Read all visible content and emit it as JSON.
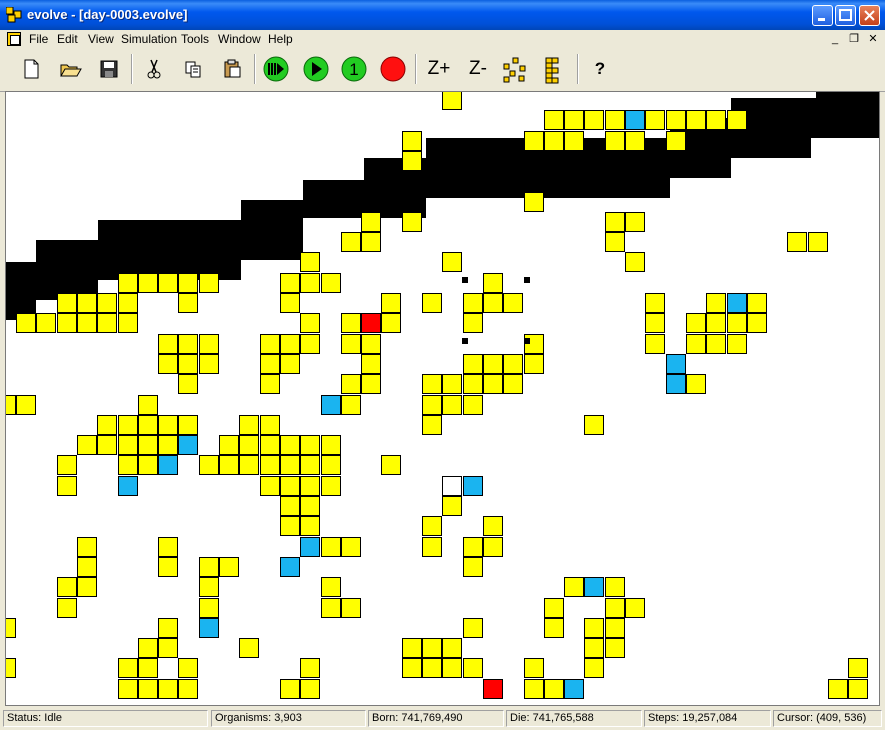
{
  "window": {
    "title": "evolve - [day-0003.evolve]"
  },
  "menu": {
    "items": [
      "File",
      "Edit",
      "View",
      "Simulation",
      "Tools",
      "Window",
      "Help"
    ]
  },
  "toolbar": {
    "zoom_in_label": "Z+",
    "zoom_out_label": "Z-",
    "step_one_label": "1"
  },
  "status": {
    "status": "Status: Idle",
    "organisms": "Organisms: 3,903",
    "born": "Born: 741,769,490",
    "die": "Die: 741,765,588",
    "steps": "Steps: 19,257,084",
    "cursor": "Cursor: (409, 536)"
  },
  "colors": {
    "organism": "#ffff00",
    "spore": "#1ab4f0",
    "selected": "#ff0000",
    "barrier": "#000000",
    "background": "#ffffff"
  }
}
